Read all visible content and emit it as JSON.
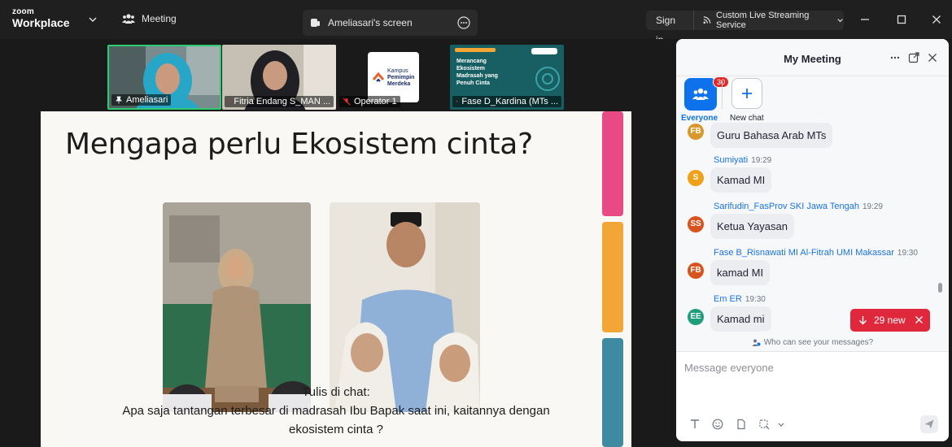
{
  "titlebar": {
    "logo_line1": "zoom",
    "logo_line2": "Workplace",
    "meeting_label": "Meeting",
    "screen_tab_label": "Ameliasari's screen",
    "signin_label": "Sign in",
    "stream_label": "Custom Live Streaming Service"
  },
  "thumbnails": [
    {
      "name": "Ameliasari",
      "active": true
    },
    {
      "name": "Fitria Endang S_MAN ..."
    },
    {
      "name": "Operator 1"
    },
    {
      "name": "Fase D_Kardina (MTs ..."
    }
  ],
  "thumb_extra": {
    "kampus_line1": "Kampus",
    "kampus_line2": "Pemimpin",
    "kampus_line3": "Merdeka",
    "fase_line1": "Merancang",
    "fase_line2": "Ekosistem",
    "fase_line3": "Madrasah yang",
    "fase_line4": "Penuh Cinta"
  },
  "slide": {
    "title": "Mengapa perlu Ekosistem cinta?",
    "caption_line1": "Tulis di chat:",
    "caption_line2": "Apa saja tantangan terbesar di madrasah Ibu Bapak saat ini, kaitannya dengan",
    "caption_line3": "ekosistem cinta ?"
  },
  "chat": {
    "title": "My Meeting",
    "tab_everyone": "Everyone",
    "tab_everyone_badge": "30",
    "tab_new_chat": "New chat",
    "messages": [
      {
        "initials": "FB",
        "color": "#d9982b",
        "sender": "",
        "time": "",
        "text": "Guru Bahasa Arab MTs"
      },
      {
        "initials": "S",
        "color": "#f0a11a",
        "sender": "Sumiyati",
        "time": "19:29",
        "text": "Kamad MI"
      },
      {
        "initials": "SS",
        "color": "#d9531e",
        "sender": "Sarifudin_FasProv SKI Jawa Tengah",
        "time": "19:29",
        "text": "Ketua Yayasan"
      },
      {
        "initials": "FB",
        "color": "#d9531e",
        "sender": "Fase B_Risnawati MI Al-Fitrah UMI Makassar",
        "time": "19:30",
        "text": "kamad MI"
      },
      {
        "initials": "EE",
        "color": "#1e9e7a",
        "sender": "Em ER",
        "time": "19:30",
        "text": "Kamad mi"
      }
    ],
    "new_pill": "29 new",
    "who_can_see": "Who can see your messages?",
    "composer_placeholder": "Message everyone"
  },
  "colors": {
    "accent": "#0e72ed",
    "alert": "#e0283c",
    "active_tile_border": "#2ecc71",
    "deco_pink": "#e84a86",
    "deco_orange": "#f3a536",
    "deco_teal": "#3e8aa0"
  }
}
